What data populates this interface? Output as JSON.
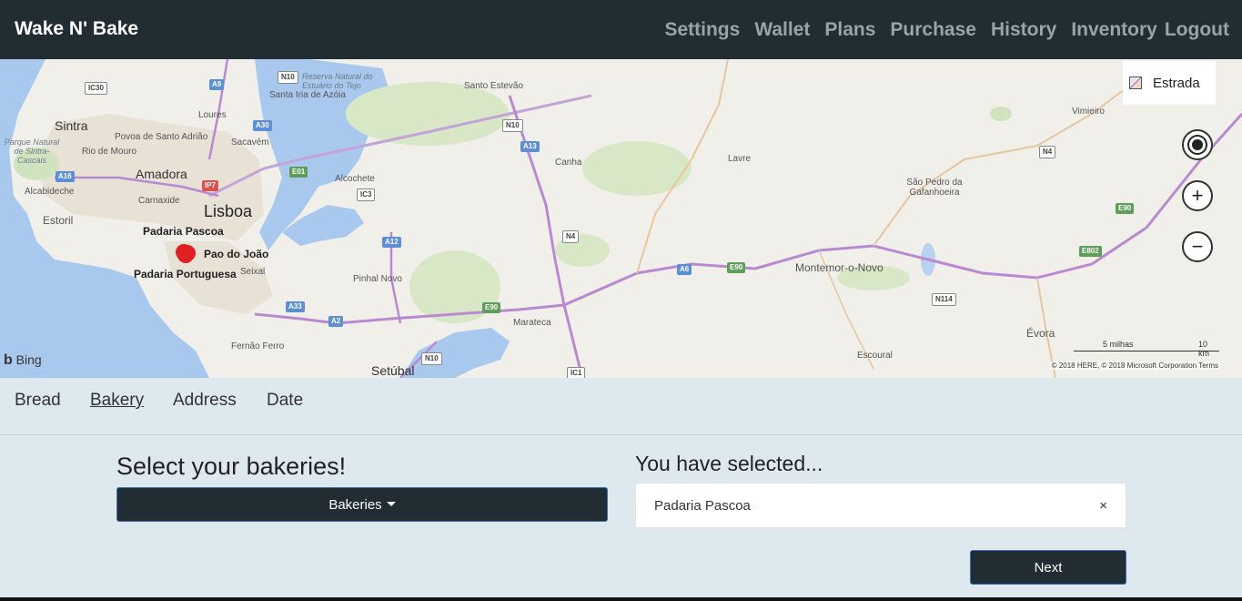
{
  "app": {
    "title": "Wake N' Bake"
  },
  "nav": {
    "items": [
      "Settings",
      "Wallet",
      "Plans",
      "Purchase",
      "History",
      "Inventory"
    ],
    "logout": "Logout"
  },
  "map": {
    "type_label": "Estrada",
    "provider": "Bing",
    "scale_miles": "5 milhas",
    "scale_km": "10 km",
    "attribution": "© 2018 HERE, © 2018 Microsoft Corporation  Terms",
    "places": {
      "lisboa": "Lisboa",
      "amadora": "Amadora",
      "sintra": "Sintra",
      "estoril": "Estoril",
      "alcabideche": "Alcabideche",
      "carnaxide": "Carnaxide",
      "sacavem": "Sacavém",
      "loures": "Loures",
      "povoa": "Povoa de Santo Adrião",
      "rio_mouro": "Rio de Mouro",
      "santa_iria": "Santa Iria de Azóia",
      "santo_estevao": "Santo Estevão",
      "alcochete": "Alcochete",
      "canha": "Canha",
      "lavre": "Lavre",
      "vimieiro": "Vimieiro",
      "sao_pedro": "São Pedro da Gafanhoeira",
      "montemor": "Montemor-o-Novo",
      "evora": "Évora",
      "escoural": "Escoural",
      "marateca": "Marateca",
      "pinhal_novo": "Pinhal Novo",
      "setubal": "Setúbal",
      "seixal": "Seixal",
      "fernao_ferro": "Fernão Ferro",
      "parque": "Parque Natural de Sintra-Cascais",
      "reserva": "Reserva Natural do Estuário do Tejo"
    },
    "bakeries": {
      "pascoa": "Padaria Pascoa",
      "joao": "Pao do João",
      "portuguesa": "Padaria Portuguesa"
    },
    "roads": {
      "ic30": "IC30",
      "a9": "A9",
      "n10a": "N10",
      "a30": "A30",
      "a16": "A16",
      "ip7": "IP7",
      "e01": "E01",
      "ic3": "IC3",
      "n10b": "N10",
      "a13": "A13",
      "a12": "A12",
      "n4a": "N4",
      "a6": "A6",
      "e90a": "E90",
      "a33": "A33",
      "a2": "A2",
      "e90b": "E90",
      "n10c": "N10",
      "ic1": "IC1",
      "n4b": "N4",
      "e90c": "E90",
      "e802": "E802",
      "n114": "N114"
    }
  },
  "tabs": {
    "bread": "Bread",
    "bakery": "Bakery",
    "address": "Address",
    "date": "Date"
  },
  "form": {
    "left_title": "Select your bakeries!",
    "dropdown_label": "Bakeries",
    "right_title": "You have selected...",
    "selected_item": "Padaria Pascoa",
    "remove_symbol": "×",
    "next_label": "Next"
  },
  "colors": {
    "navbar": "#212d33",
    "page_bg": "#dde9ee",
    "button_border": "#3b6fb6",
    "marker": "#e02020"
  }
}
